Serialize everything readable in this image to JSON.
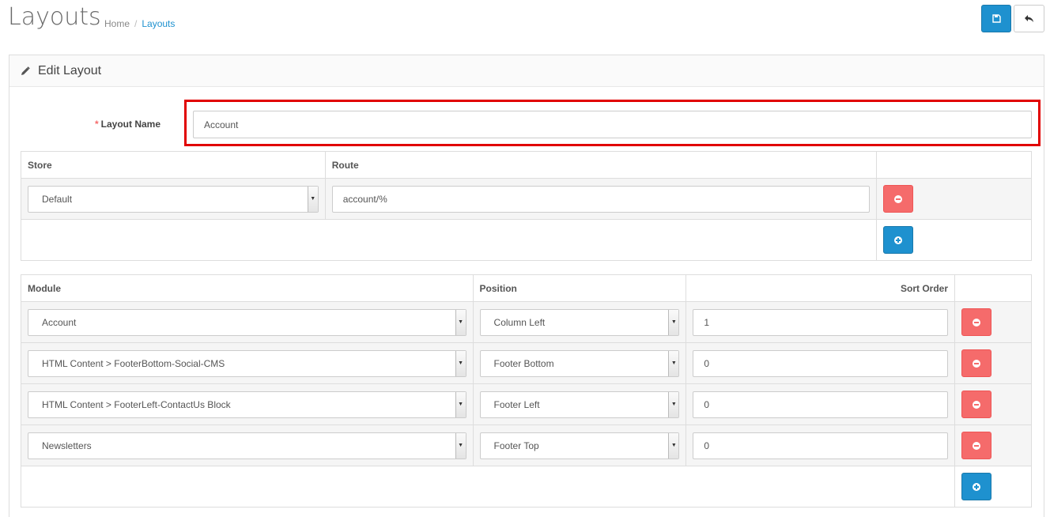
{
  "header": {
    "title": "Layouts",
    "breadcrumb": {
      "home": "Home",
      "separator": "/",
      "current": "Layouts"
    }
  },
  "panel": {
    "title": "Edit Layout"
  },
  "form": {
    "required_mark": "*",
    "layout_name_label": "Layout Name",
    "layout_name_value": "Account"
  },
  "routes": {
    "headers": {
      "store": "Store",
      "route": "Route"
    },
    "rows": [
      {
        "store": "Default",
        "route": "account/%"
      }
    ]
  },
  "modules": {
    "headers": {
      "module": "Module",
      "position": "Position",
      "sort_order": "Sort Order"
    },
    "rows": [
      {
        "module": "Account",
        "position": "Column Left",
        "sort": "1"
      },
      {
        "module": "HTML Content > FooterBottom-Social-CMS",
        "position": "Footer Bottom",
        "sort": "0"
      },
      {
        "module": "HTML Content > FooterLeft-ContactUs Block",
        "position": "Footer Left",
        "sort": "0"
      },
      {
        "module": "Newsletters",
        "position": "Footer Top",
        "sort": "0"
      }
    ]
  },
  "colors": {
    "primary": "#1e91cf",
    "danger": "#f56b6b",
    "highlight": "#e10000"
  }
}
